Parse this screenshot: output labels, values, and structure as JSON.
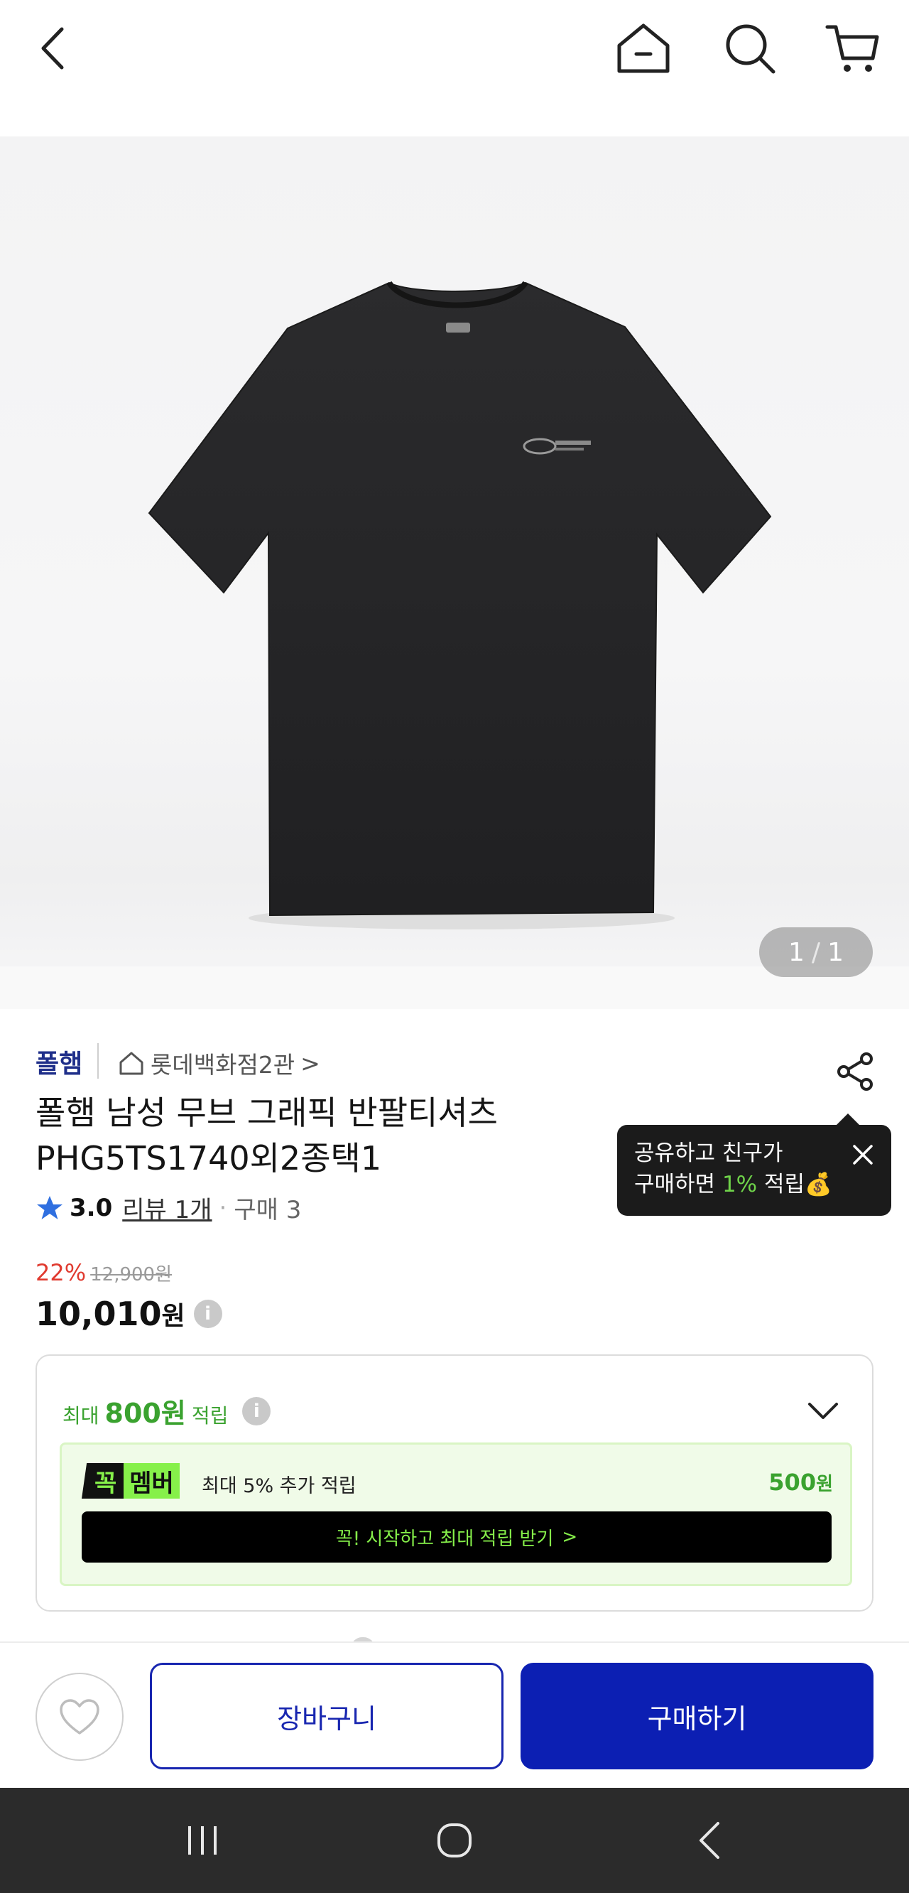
{
  "header": {
    "back_icon": "chevron-left-icon",
    "home_icon": "home-icon",
    "search_icon": "search-icon",
    "cart_icon": "cart-icon"
  },
  "gallery": {
    "current": "1",
    "separator": "/",
    "total": "1"
  },
  "product": {
    "brand": "폴햄",
    "store": "롯데백화점2관",
    "store_chevron": ">",
    "title_line1": "폴햄 남성 무브 그래픽 반팔티셔츠",
    "title_line2": "PHG5TS1740외2종택1",
    "rating": "3.0",
    "reviews": "리뷰 1개",
    "dot": "·",
    "purchases": "구매 3",
    "discount_pct": "22%",
    "original_price": "12,900원",
    "price": "10,010",
    "price_unit": "원",
    "info_icon": "i"
  },
  "share_tooltip": {
    "line1": "공유하고 친구가",
    "line2_prefix": "구매하면 ",
    "line2_highlight": "1%",
    "line2_suffix": " 적립💰"
  },
  "points": {
    "prefix": "최대",
    "amount": "800원",
    "suffix": "적립",
    "info_icon": "i",
    "member_badge_k": "꼭",
    "member_badge_m": "멤버",
    "member_text": "최대 5% 추가 적립",
    "member_amount": "500",
    "member_amount_unit": "원",
    "cta_label": "꼭! 시작하고 최대 적립 받기",
    "cta_chevron": ">"
  },
  "actions": {
    "wishlist_icon": "heart-icon",
    "cart_label": "장바구니",
    "buy_label": "구매하기"
  },
  "colors": {
    "brand_blue": "#0c1fb3",
    "discount_red": "#e03a2f",
    "points_green": "#3aa22f",
    "member_lime": "#86f04a"
  }
}
